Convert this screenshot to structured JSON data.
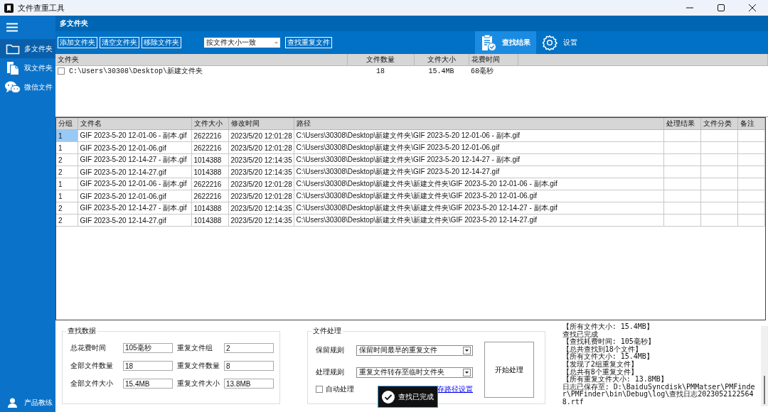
{
  "window": {
    "title": "文件查重工具"
  },
  "sidebar": {
    "items": [
      {
        "label": "多文件夹",
        "kind": "folder",
        "selected": true
      },
      {
        "label": "双文件夹",
        "kind": "documents",
        "selected": false
      },
      {
        "label": "微信文件",
        "kind": "chat",
        "selected": false
      }
    ],
    "footer": {
      "label": "产品教练"
    }
  },
  "header": {
    "title": "多文件夹"
  },
  "toolbar": {
    "buttons": [
      "添加文件夹",
      "清空文件夹",
      "移除文件夹"
    ],
    "match_mode": "按文件大小一致",
    "search_button": "查找重复文件",
    "tabs": [
      {
        "label": "查找结果",
        "kind": "results",
        "selected": true
      },
      {
        "label": "设置",
        "kind": "settings",
        "selected": false
      }
    ]
  },
  "folders": {
    "columns": [
      "文件夹",
      "文件数量",
      "文件大小",
      "花费时间"
    ],
    "rows": [
      {
        "checked": false,
        "cells": [
          "C:\\Users\\30308\\Desktop\\新建文件夹",
          "18",
          "15.4MB",
          "68毫秒"
        ]
      }
    ]
  },
  "results": {
    "columns": [
      "分组",
      "文件名",
      "文件大小",
      "修改时间",
      "路径",
      "处理结果",
      "文件分类",
      "备注"
    ],
    "rows": [
      {
        "selected": true,
        "cells": [
          "1",
          "GIF 2023-5-20 12-01-06 - 副本.gif",
          "2622216",
          "2023/5/20 12:01:28",
          "C:\\Users\\30308\\Desktop\\新建文件夹\\GIF 2023-5-20 12-01-06 - 副本.gif"
        ]
      },
      {
        "selected": false,
        "cells": [
          "1",
          "GIF 2023-5-20 12-01-06.gif",
          "2622216",
          "2023/5/20 12:01:28",
          "C:\\Users\\30308\\Desktop\\新建文件夹\\GIF 2023-5-20 12-01-06.gif"
        ]
      },
      {
        "selected": false,
        "cells": [
          "2",
          "GIF 2023-5-20 12-14-27 - 副本.gif",
          "1014388",
          "2023/5/20 12:14:35",
          "C:\\Users\\30308\\Desktop\\新建文件夹\\GIF 2023-5-20 12-14-27 - 副本.gif"
        ]
      },
      {
        "selected": false,
        "cells": [
          "2",
          "GIF 2023-5-20 12-14-27.gif",
          "1014388",
          "2023/5/20 12:14:35",
          "C:\\Users\\30308\\Desktop\\新建文件夹\\GIF 2023-5-20 12-14-27.gif"
        ]
      },
      {
        "selected": false,
        "cells": [
          "1",
          "GIF 2023-5-20 12-01-06 - 副本.gif",
          "2622216",
          "2023/5/20 12:01:28",
          "C:\\Users\\30308\\Desktop\\新建文件夹\\新建文件夹\\GIF 2023-5-20 12-01-06 - 副本.gif"
        ]
      },
      {
        "selected": false,
        "cells": [
          "1",
          "GIF 2023-5-20 12-01-06.gif",
          "2622216",
          "2023/5/20 12:01:28",
          "C:\\Users\\30308\\Desktop\\新建文件夹\\新建文件夹\\GIF 2023-5-20 12-01-06.gif"
        ]
      },
      {
        "selected": false,
        "cells": [
          "2",
          "GIF 2023-5-20 12-14-27 - 副本.gif",
          "1014388",
          "2023/5/20 12:14:35",
          "C:\\Users\\30308\\Desktop\\新建文件夹\\新建文件夹\\GIF 2023-5-20 12-14-27 - 副本.gif"
        ]
      },
      {
        "selected": false,
        "cells": [
          "2",
          "GIF 2023-5-20 12-14-27.gif",
          "1014388",
          "2023/5/20 12:14:35",
          "C:\\Users\\30308\\Desktop\\新建文件夹\\新建文件夹\\GIF 2023-5-20 12-14-27.gif"
        ]
      }
    ]
  },
  "stats": {
    "title": "查找数据",
    "fields": [
      {
        "label": "总花费时间",
        "value": "105毫秒"
      },
      {
        "label": "重复文件组",
        "value": "2"
      },
      {
        "label": "全部文件数量",
        "value": "18"
      },
      {
        "label": "重复文件数量",
        "value": "8"
      },
      {
        "label": "全部文件大小",
        "value": "15.4MB"
      },
      {
        "label": "重复文件大小",
        "value": "13.8MB"
      }
    ]
  },
  "processing": {
    "title": "文件处理",
    "rules": [
      {
        "label": "保留规则",
        "value": "保留时间最早的重复文件"
      },
      {
        "label": "处理规则",
        "value": "重复文件转存至临时文件夹"
      }
    ],
    "auto": {
      "label": "自动处理",
      "checked": false
    },
    "link": "存路径设置",
    "start_button": "开始处理"
  },
  "toast": {
    "text": "查找已完成"
  },
  "log": {
    "lines": [
      "【所有文件大小: 15.4MB】",
      "查找已完成",
      "【查找耗费时间: 105毫秒】",
      "【总共查找到18个文件】",
      "【所有文件大小: 15.4MB】",
      "【发现了2组重复文件】",
      "【总共有8个重复文件】",
      "【所有重复文件大小: 13.8MB】",
      "日志已保存至: D:\\BaiduSyncdisk\\PMMatser\\PMFinder\\PMFinder\\bin\\Debug\\log\\查找日志20230521225648.rtf"
    ]
  }
}
